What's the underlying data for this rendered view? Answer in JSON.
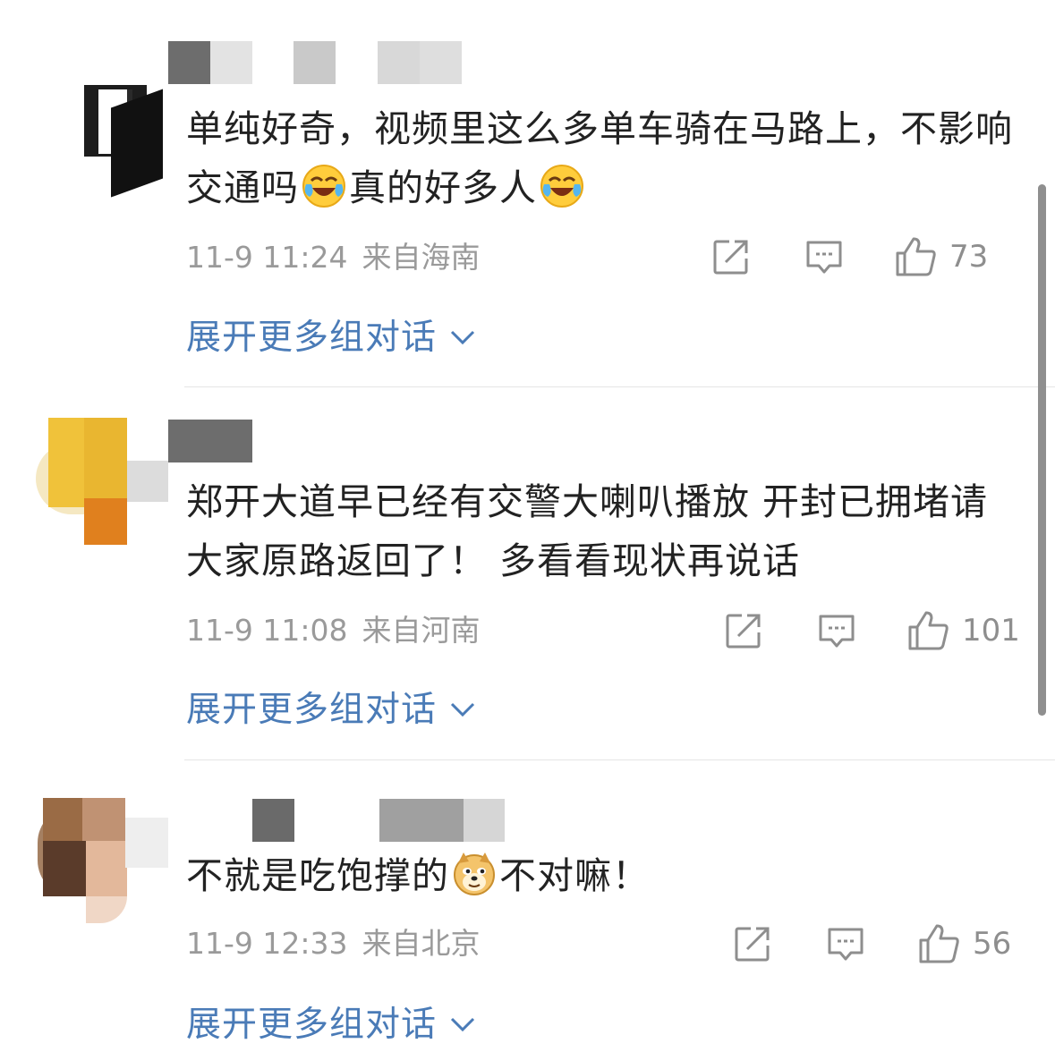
{
  "comments": [
    {
      "text_part1": "单纯好奇，视频里这么多单车骑在马路上，不影响交通吗",
      "text_part2": "真的好多人",
      "emoji": "laugh-cry-emoji",
      "date": "11-9 11:24",
      "location": "来自海南",
      "likes": "73",
      "expand_label": "展开更多组对话"
    },
    {
      "text": "郑开大道早已经有交警大喇叭播放 开封已拥堵请大家原路返回了！ 多看看现状再说话",
      "date": "11-9 11:08",
      "location": "来自河南",
      "likes": "101",
      "expand_label": "展开更多组对话"
    },
    {
      "text_part1": "不就是吃饱撑的",
      "text_part2": "不对嘛！",
      "emoji": "doge-emoji",
      "date": "11-9 12:33",
      "location": "来自北京",
      "likes": "56",
      "expand_label": "展开更多组对话"
    }
  ],
  "icons": {
    "share": "share-icon",
    "reply": "comment-icon",
    "like": "thumbs-up-icon",
    "expand": "chevron-down-icon"
  },
  "colors": {
    "text": "#222222",
    "meta": "#9a9a9a",
    "link": "#4a7bb7",
    "divider": "#e5e5e5"
  }
}
